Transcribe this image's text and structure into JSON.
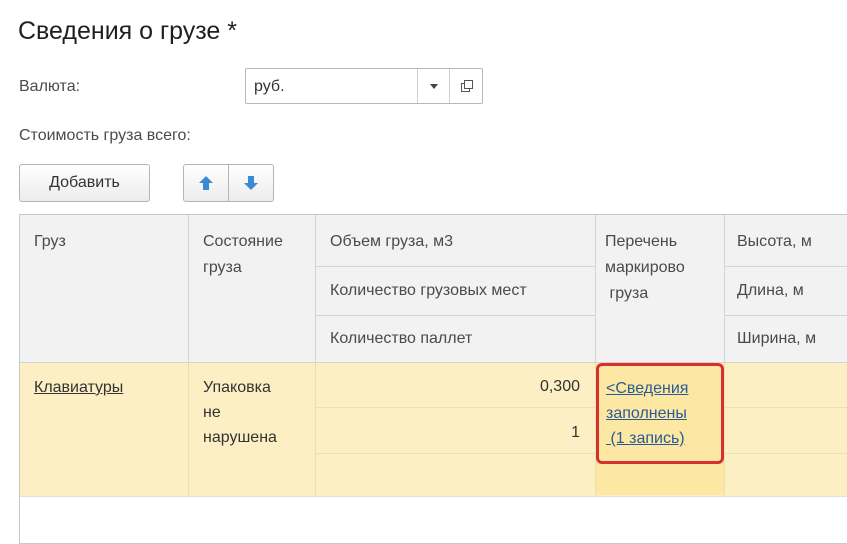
{
  "form": {
    "title": "Сведения о грузе *",
    "currency_label": "Валюта:",
    "currency_value": "руб.",
    "total_cost_label": "Стоимость груза всего:"
  },
  "toolbar": {
    "add_label": "Добавить",
    "up_icon": "arrow-up-icon",
    "down_icon": "arrow-down-icon"
  },
  "table": {
    "headers": {
      "cargo": "Груз",
      "state_line1": "Состояние",
      "state_line2": "груза",
      "volume": "Объем груза, м3",
      "places": "Количество грузовых мест",
      "pallets": "Количество паллет",
      "marking_line1": "Перечень",
      "marking_line2": "маркирово",
      "marking_line3": " груза",
      "height": "Высота, м",
      "length": "Длина, м",
      "width": "Ширина, м"
    },
    "rows": [
      {
        "cargo": "Клавиатуры",
        "state_line1": "Упаковка",
        "state_line2": "не",
        "state_line3": "нарушена",
        "volume": "0,300",
        "places": "1",
        "marking_line1": "<Сведения",
        "marking_line2": "заполнены",
        "marking_line3": " (1 запись)"
      }
    ]
  },
  "colors": {
    "accent_border": "#d63030",
    "row_bg": "#fbefc3",
    "link": "#2a5a96",
    "arrow_icon": "#3a8ad6"
  }
}
